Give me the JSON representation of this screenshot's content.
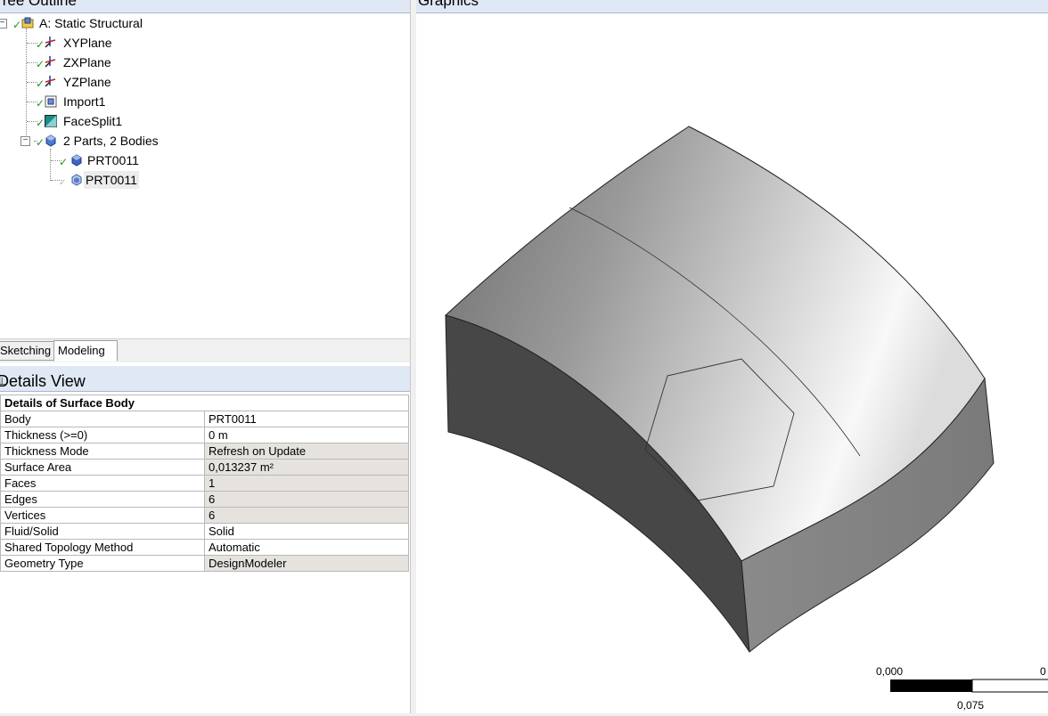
{
  "tree_outline": {
    "title": "Tree Outline",
    "items": [
      {
        "label": "A: Static Structural",
        "icon": "model-icon"
      },
      {
        "label": "XYPlane",
        "icon": "plane-axes-icon"
      },
      {
        "label": "ZXPlane",
        "icon": "plane-axes-icon"
      },
      {
        "label": "YZPlane",
        "icon": "plane-axes-icon"
      },
      {
        "label": "Import1",
        "icon": "import-icon"
      },
      {
        "label": "FaceSplit1",
        "icon": "face-split-icon"
      },
      {
        "label": "2 Parts, 2 Bodies",
        "icon": "parts-icon"
      },
      {
        "label": "PRT0011",
        "icon": "solid-body-icon"
      },
      {
        "label": "PRT0011",
        "icon": "surface-body-icon"
      }
    ]
  },
  "tabs": {
    "sketching": "Sketching",
    "modeling": "Modeling",
    "active": "Modeling"
  },
  "details_view": {
    "title": "Details View",
    "header": "Details of Surface Body",
    "rows": [
      {
        "key": "Body",
        "value": "PRT0011"
      },
      {
        "key": "Thickness (>=0)",
        "value": "0 m"
      },
      {
        "key": "Thickness Mode",
        "value": "Refresh on Update"
      },
      {
        "key": "Surface Area",
        "value": "0,013237 m²"
      },
      {
        "key": "Faces",
        "value": "1"
      },
      {
        "key": "Edges",
        "value": "6"
      },
      {
        "key": "Vertices",
        "value": "6"
      },
      {
        "key": "Fluid/Solid",
        "value": "Solid"
      },
      {
        "key": "Shared Topology Method",
        "value": "Automatic"
      },
      {
        "key": "Geometry Type",
        "value": "DesignModeler"
      }
    ]
  },
  "graphics": {
    "title": "Graphics",
    "scale_bar": {
      "start": "0,000",
      "end": "0",
      "mid": "0,075"
    }
  },
  "colors": {
    "check": "#1a9a1a",
    "panel_header": "#dfe8f4",
    "shaded_value": "#e6e3de"
  }
}
